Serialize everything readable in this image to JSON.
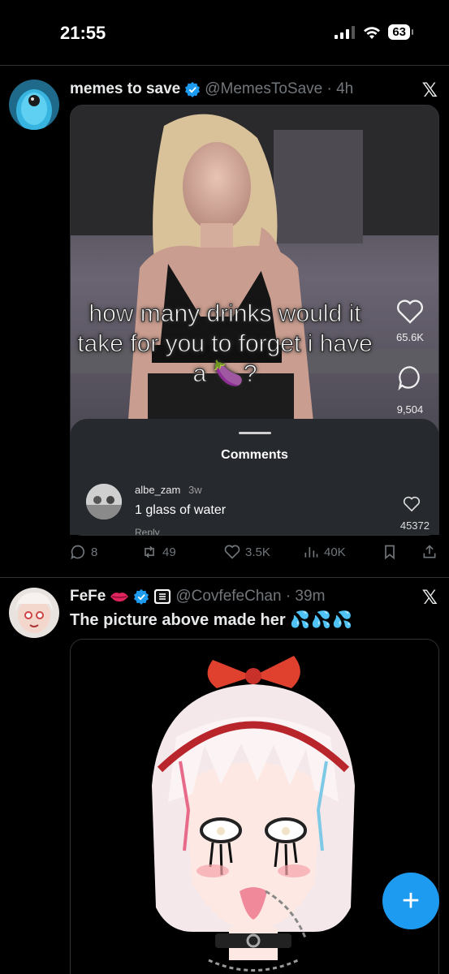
{
  "status_bar": {
    "time": "21:55",
    "battery": "63"
  },
  "tweets": [
    {
      "display_name": "memes to save",
      "handle_time": "@MemesToSave · 4h",
      "close_icon": "x-logo-icon",
      "media": {
        "overlay_text": "how many drinks would it take for you to forget i have a 🍆?",
        "side_likes": "65.6K",
        "side_comments": "9,504",
        "comments_title": "Comments",
        "commenter": "albe_zam",
        "commenter_time": "3w",
        "comment": "1 glass of water",
        "reply": "Reply",
        "comment_likes": "45372"
      },
      "actions": {
        "replies": "8",
        "reposts": "49",
        "likes": "3.5K",
        "views": "40K"
      }
    },
    {
      "display_name": "FeFe",
      "handle_time": "@CovfefeChan · 39m",
      "text": "The picture above made her",
      "text_emoji": "💦💦💦"
    }
  ],
  "colors": {
    "accent": "#1d9bf0",
    "muted": "#71767b",
    "background": "#000000"
  }
}
